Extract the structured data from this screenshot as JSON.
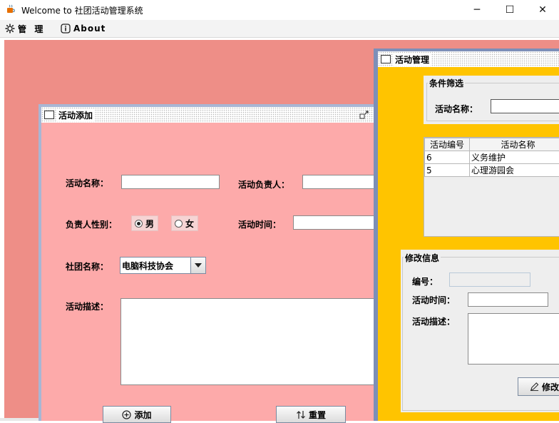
{
  "window": {
    "title": "Welcome to 社团活动管理系统",
    "minimize": "─",
    "maximize": "☐",
    "close": "✕"
  },
  "menubar": {
    "items": [
      {
        "label": "管  理",
        "icon": "gear-icon"
      },
      {
        "label": "About",
        "icon": "info-icon"
      }
    ]
  },
  "add_frame": {
    "title": "活动添加",
    "name_label": "活动名称：",
    "name_value": "",
    "leader_label": "活动负责人：",
    "leader_value": "",
    "gender_label": "负责人性别：",
    "gender_options": [
      "男",
      "女"
    ],
    "gender_selected": "男",
    "time_label": "活动时间：",
    "time_value": "",
    "club_label": "社团名称：",
    "club_selected": "电脑科技协会",
    "desc_label": "活动描述：",
    "desc_value": "",
    "add_button": "添加",
    "reset_button": "重置"
  },
  "manage_frame": {
    "title": "活动管理",
    "filter_group": "条件筛选",
    "filter_name_label": "活动名称：",
    "filter_name_value": "",
    "table": {
      "columns": [
        "活动编号",
        "活动名称"
      ],
      "rows": [
        [
          "6",
          "义务维护"
        ],
        [
          "5",
          "心理游园会"
        ]
      ]
    },
    "edit_group": "修改信息",
    "id_label": "编号：",
    "id_value": "",
    "time_label": "活动时间：",
    "time_value": "",
    "desc_label": "活动描述：",
    "desc_value": "",
    "modify_button": "修改"
  },
  "colors": {
    "desktop": "#ee8e87",
    "add_body": "#fdaaaa",
    "manage_body": "#ffc400"
  }
}
